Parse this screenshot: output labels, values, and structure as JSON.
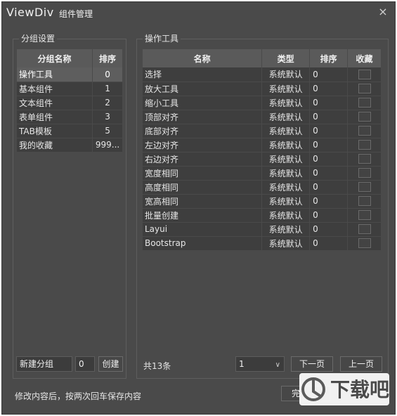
{
  "window": {
    "app_name": "ViewDiv",
    "title": "组件管理",
    "close_symbol": "×"
  },
  "left_panel": {
    "legend": "分组设置",
    "headers": {
      "name": "分组名称",
      "order": "排序"
    },
    "rows": [
      {
        "name": "操作工具",
        "order": "0",
        "selected": true
      },
      {
        "name": "基本组件",
        "order": "1"
      },
      {
        "name": "文本组件",
        "order": "2"
      },
      {
        "name": "表单组件",
        "order": "3"
      },
      {
        "name": "TAB模板",
        "order": "5"
      },
      {
        "name": "我的收藏",
        "order": "999..."
      }
    ],
    "new_group": {
      "name_value": "新建分组",
      "order_value": "0",
      "create_label": "创建"
    }
  },
  "right_panel": {
    "legend": "操作工具",
    "headers": {
      "name": "名称",
      "type": "类型",
      "order": "排序",
      "favorite": "收藏"
    },
    "rows": [
      {
        "name": "选择",
        "type": "系统默认",
        "order": "0"
      },
      {
        "name": "放大工具",
        "type": "系统默认",
        "order": "0"
      },
      {
        "name": "缩小工具",
        "type": "系统默认",
        "order": "0"
      },
      {
        "name": "顶部对齐",
        "type": "系统默认",
        "order": "0"
      },
      {
        "name": "底部对齐",
        "type": "系统默认",
        "order": "0"
      },
      {
        "name": "左边对齐",
        "type": "系统默认",
        "order": "0"
      },
      {
        "name": "右边对齐",
        "type": "系统默认",
        "order": "0"
      },
      {
        "name": "宽度相同",
        "type": "系统默认",
        "order": "0"
      },
      {
        "name": "高度相同",
        "type": "系统默认",
        "order": "0"
      },
      {
        "name": "宽高相同",
        "type": "系统默认",
        "order": "0"
      },
      {
        "name": "批量创建",
        "type": "系统默认",
        "order": "0"
      },
      {
        "name": "Layui",
        "type": "系统默认",
        "order": "0"
      },
      {
        "name": "Bootstrap",
        "type": "系统默认",
        "order": "0"
      }
    ],
    "pager": {
      "total": "共13条",
      "page_value": "1",
      "next_label": "下一页",
      "prev_label": "上一页"
    }
  },
  "footer": {
    "hint": "修改内容后，按两次回车保存内容",
    "done_label": "完"
  },
  "watermark": {
    "text": "下载吧"
  },
  "colors": {
    "window_bg": "#4a4a4a",
    "table_row": "#3e3e3e",
    "selected_row": "#5e5e5e",
    "header_bg": "#5a5a5a"
  }
}
